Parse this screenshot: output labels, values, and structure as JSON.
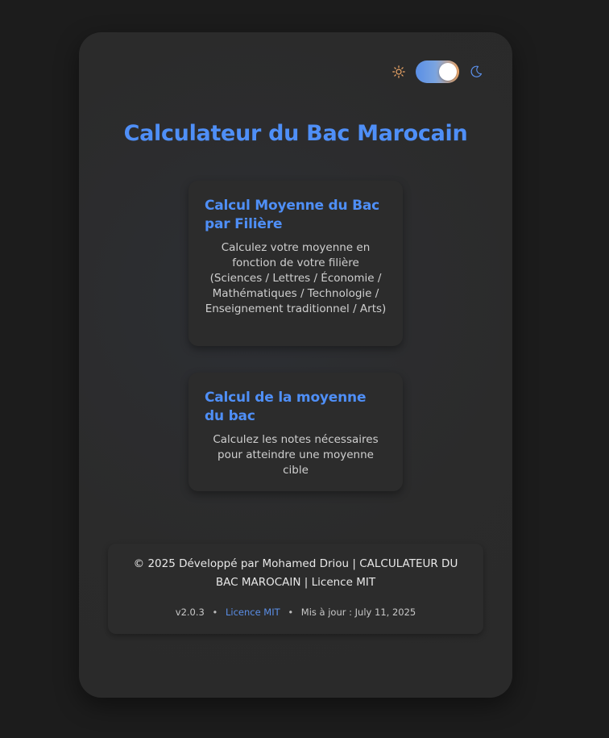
{
  "header": {
    "title": "Calculateur du Bac Marocain"
  },
  "theme_toggle": {
    "sun_icon": "sun-icon",
    "moon_icon": "moon-icon",
    "state": "dark"
  },
  "cards": [
    {
      "title": "Calcul Moyenne du Bac par Filière",
      "description": "Calculez votre moyenne en fonction de votre filière (Sciences / Lettres / Économie / Mathématiques / Technologie / Enseignement traditionnel / Arts)"
    },
    {
      "title": "Calcul de la moyenne du bac",
      "description": "Calculez les notes nécessaires pour atteindre une moyenne cible"
    }
  ],
  "footer": {
    "copyright": "© 2025 Développé par Mohamed Driou | CALCULATEUR DU BAC MAROCAIN | Licence MIT",
    "version": "v2.0.3",
    "separator": "•",
    "license_link": "Licence MIT",
    "updated": "Mis à jour : July 11, 2025"
  },
  "colors": {
    "accent": "#4f8ff7",
    "background": "#1c1c1c",
    "card": "#2c2c2c",
    "sun": "#f0a868"
  }
}
